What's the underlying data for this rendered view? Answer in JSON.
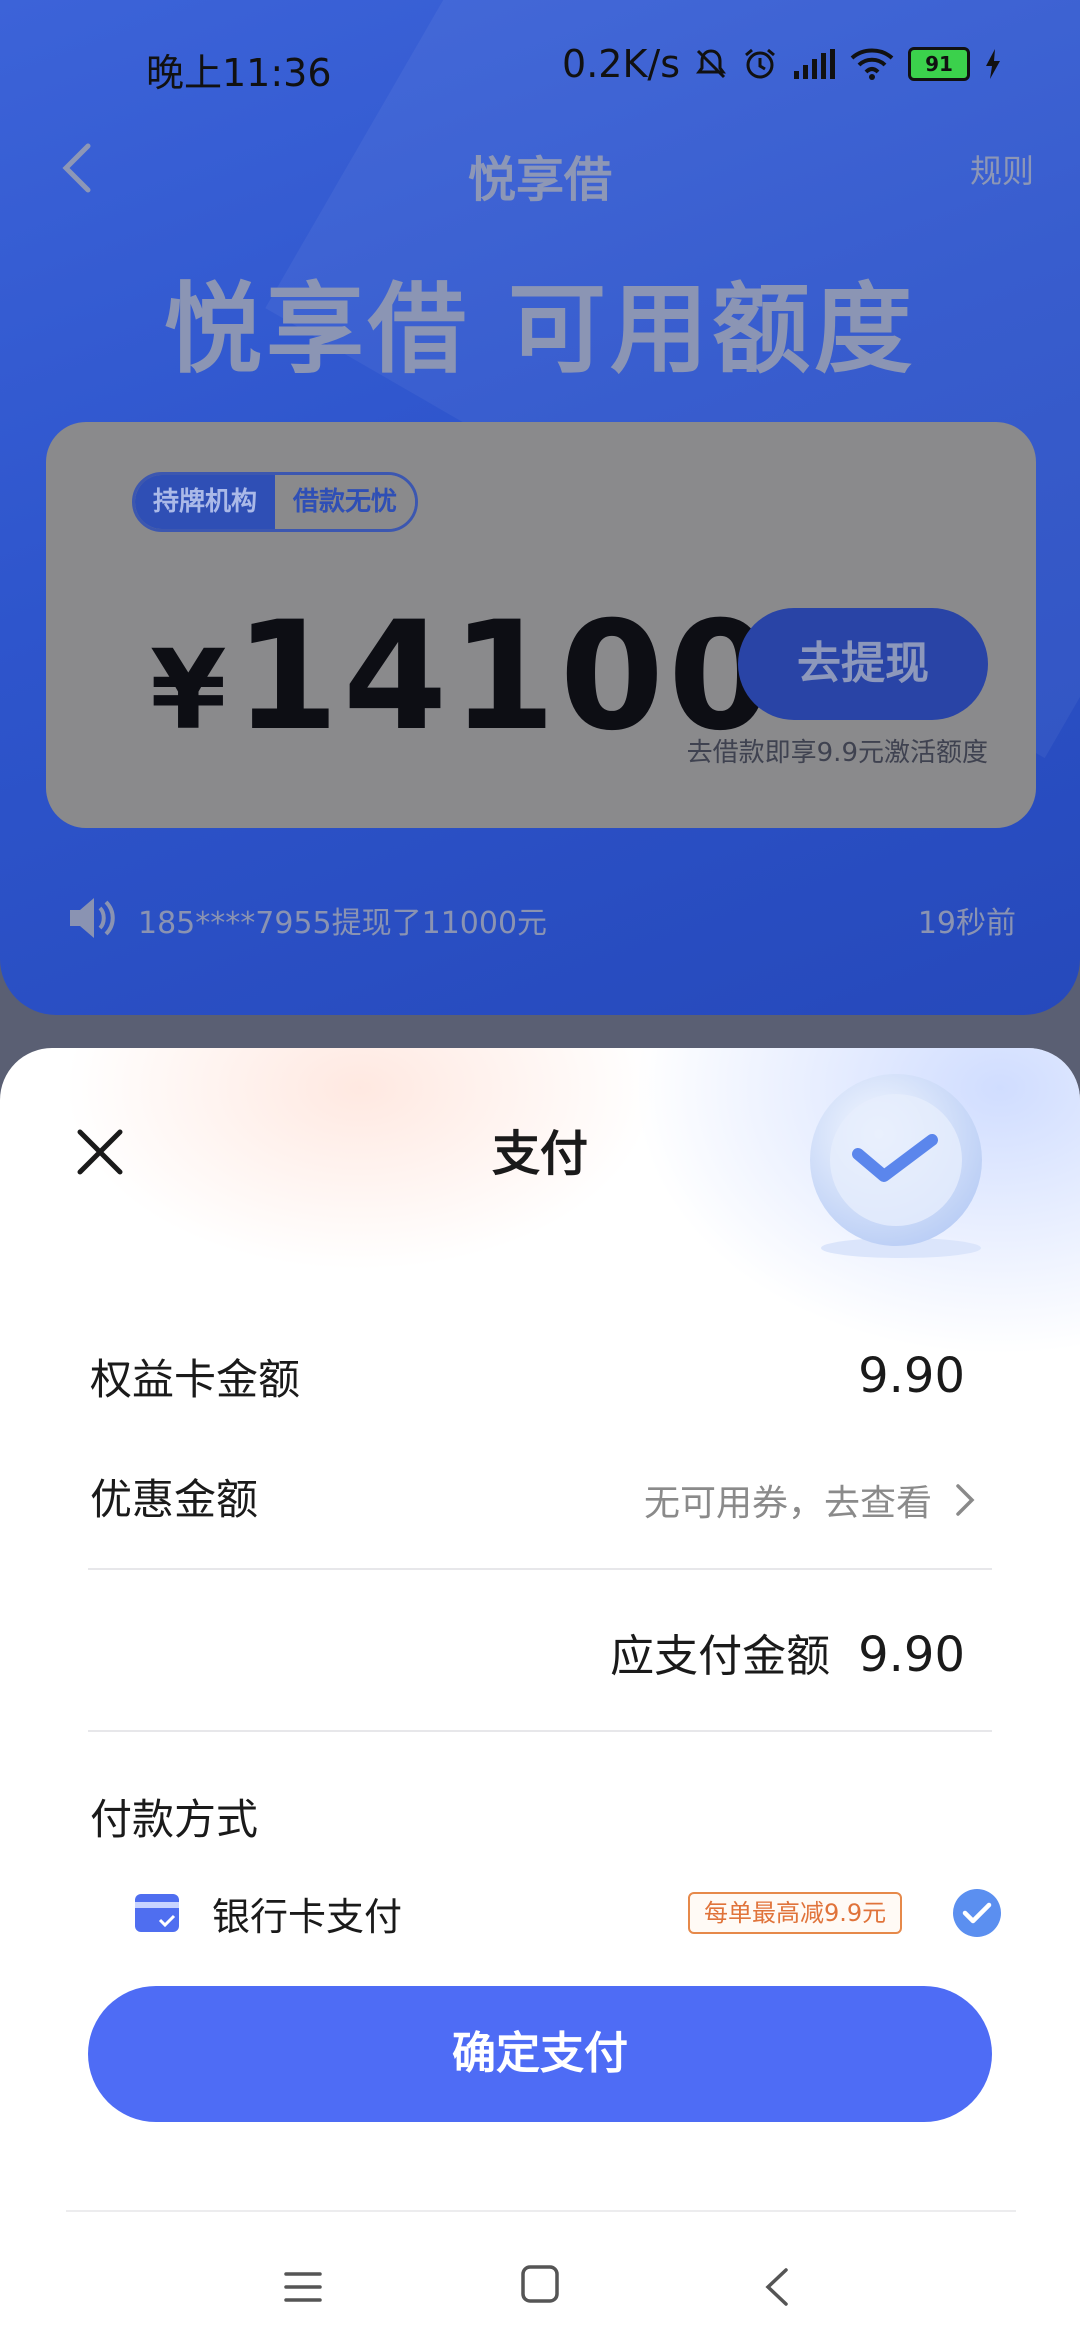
{
  "status_bar": {
    "time": "晚上11:36",
    "network_speed": "0.2K/s",
    "battery": "91",
    "icons": [
      "mute-icon",
      "alarm-icon",
      "signal-icon",
      "wifi-icon",
      "battery-icon",
      "charging-icon"
    ]
  },
  "header": {
    "title": "悦享借",
    "rules": "规则"
  },
  "hero": {
    "title": "悦享借 可用额度"
  },
  "credit_card": {
    "tag_licensed": "持牌机构",
    "tag_worry_free": "借款无忧",
    "currency": "¥",
    "amount": "14100",
    "withdraw_label": "去提现",
    "note": "去借款即享9.9元激活额度"
  },
  "ticker": {
    "text": "185****7955提现了11000元",
    "time": "19秒前"
  },
  "payment_sheet": {
    "title": "支付",
    "card_amount_label": "权益卡金额",
    "card_amount_value": "9.90",
    "discount_label": "优惠金额",
    "discount_value": "无可用券，去查看",
    "total_label": "应支付金额",
    "total_value": "9.90",
    "method_section_title": "付款方式",
    "method_label": "银行卡支付",
    "method_promo": "每单最高减9.9元",
    "method_selected": true,
    "confirm_label": "确定支付"
  },
  "colors": {
    "hero_blue": "#2e55cc",
    "primary_button": "#4e6cf5",
    "promo_orange": "#e0733a",
    "check_blue": "#5b8ff0"
  }
}
